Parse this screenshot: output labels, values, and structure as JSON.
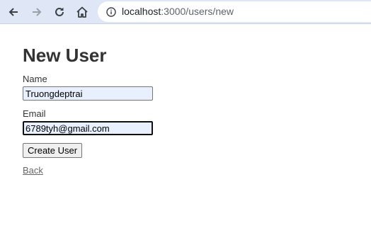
{
  "browser": {
    "url_host": "localhost",
    "url_path": ":3000/users/new"
  },
  "page": {
    "title": "New User",
    "name_label": "Name",
    "name_value": "Truongdeptrai",
    "email_label": "Email",
    "email_value": "6789tyh@gmail.com",
    "submit_label": "Create User",
    "back_label": "Back"
  },
  "colors": {
    "toolbar_bg": "#dfe7f7",
    "autofill_bg": "#e8f0fe",
    "text": "#333333"
  }
}
